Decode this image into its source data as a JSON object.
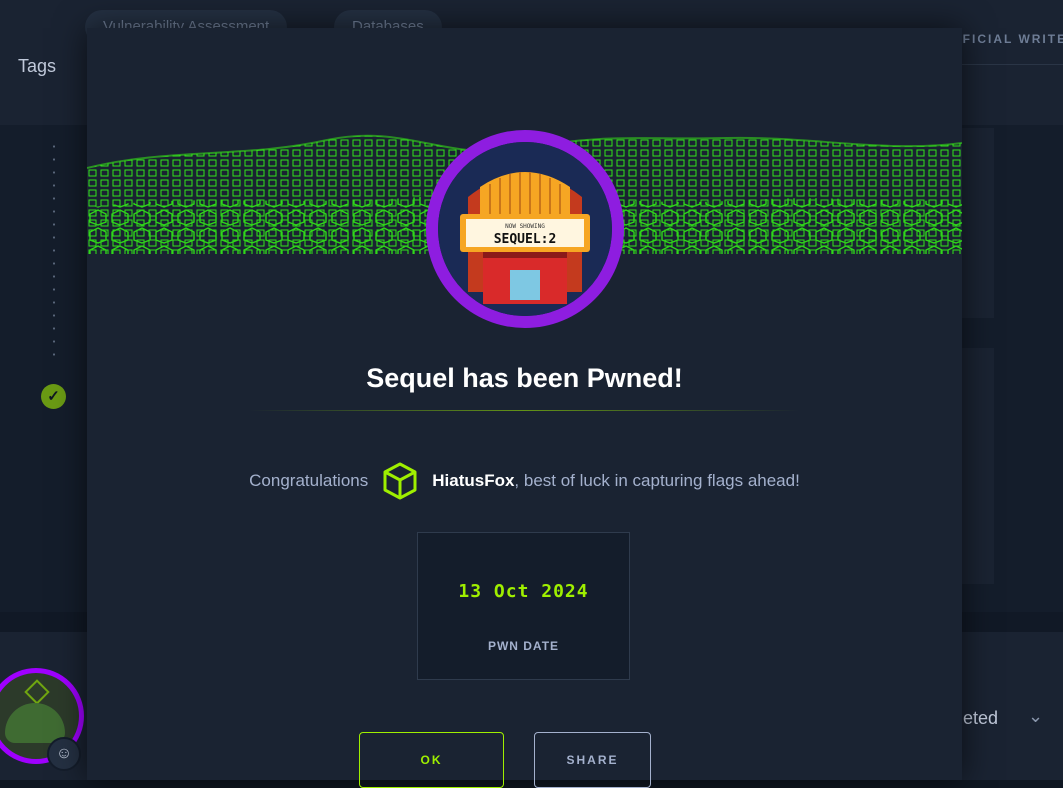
{
  "background": {
    "chips": [
      "Vulnerability Assessment",
      "Databases"
    ],
    "tags_label": "Tags",
    "right_header": "OFFICIAL WRITEUP",
    "completed_label": "Completed"
  },
  "modal": {
    "machine_art_text_top": "NOW SHOWING",
    "machine_art_text_main": "SEQUEL:2",
    "title": "Sequel has been Pwned!",
    "congrats_prefix": "Congratulations",
    "username": "HiatusFox",
    "congrats_suffix": ", best of luck in capturing flags ahead!",
    "pwn_date": "13 Oct 2024",
    "pwn_date_label": "PWN DATE",
    "ok_label": "OK",
    "share_label": "SHARE"
  },
  "colors": {
    "accent": "#9fef00",
    "ring": "#9f00ff",
    "modal_bg": "#1a2332"
  },
  "icons": [
    "check-icon",
    "cube-icon",
    "chevron-down-icon",
    "avatar-badge-icon"
  ]
}
